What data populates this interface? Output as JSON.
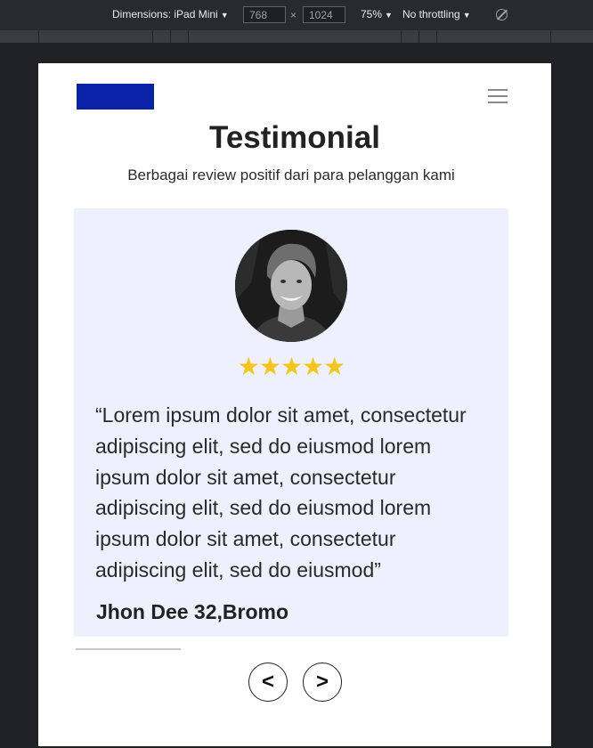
{
  "devtools": {
    "dimensions_label": "Dimensions: iPad Mini",
    "width_value": "768",
    "height_value": "1024",
    "times_sign": "×",
    "zoom": "75%",
    "throttling": "No throttling",
    "caret_icon": "▼",
    "rotate_icon": "rotate-icon"
  },
  "page": {
    "logo_color": "#0a22a8",
    "menu_icon": "hamburger-icon",
    "title": "Testimonial",
    "subtitle": "Berbagai review positif dari para pelanggan kami"
  },
  "testimonial": {
    "card_color": "#eef0fd",
    "avatar": "profile-photo",
    "stars": "★★★★★",
    "rating": 5,
    "rating_max": 5,
    "star_color": "#f5c518",
    "quote": "“Lorem ipsum dolor sit amet, consectetur adipiscing elit, sed do eiusmod lorem ipsum dolor sit amet, consectetur adipiscing elit, sed do eiusmod lorem ipsum dolor sit amet, consectetur adipiscing elit, sed do eiusmod”",
    "author": "Jhon Dee 32,Bromo"
  },
  "carousel": {
    "prev_label": "<",
    "next_label": ">"
  }
}
